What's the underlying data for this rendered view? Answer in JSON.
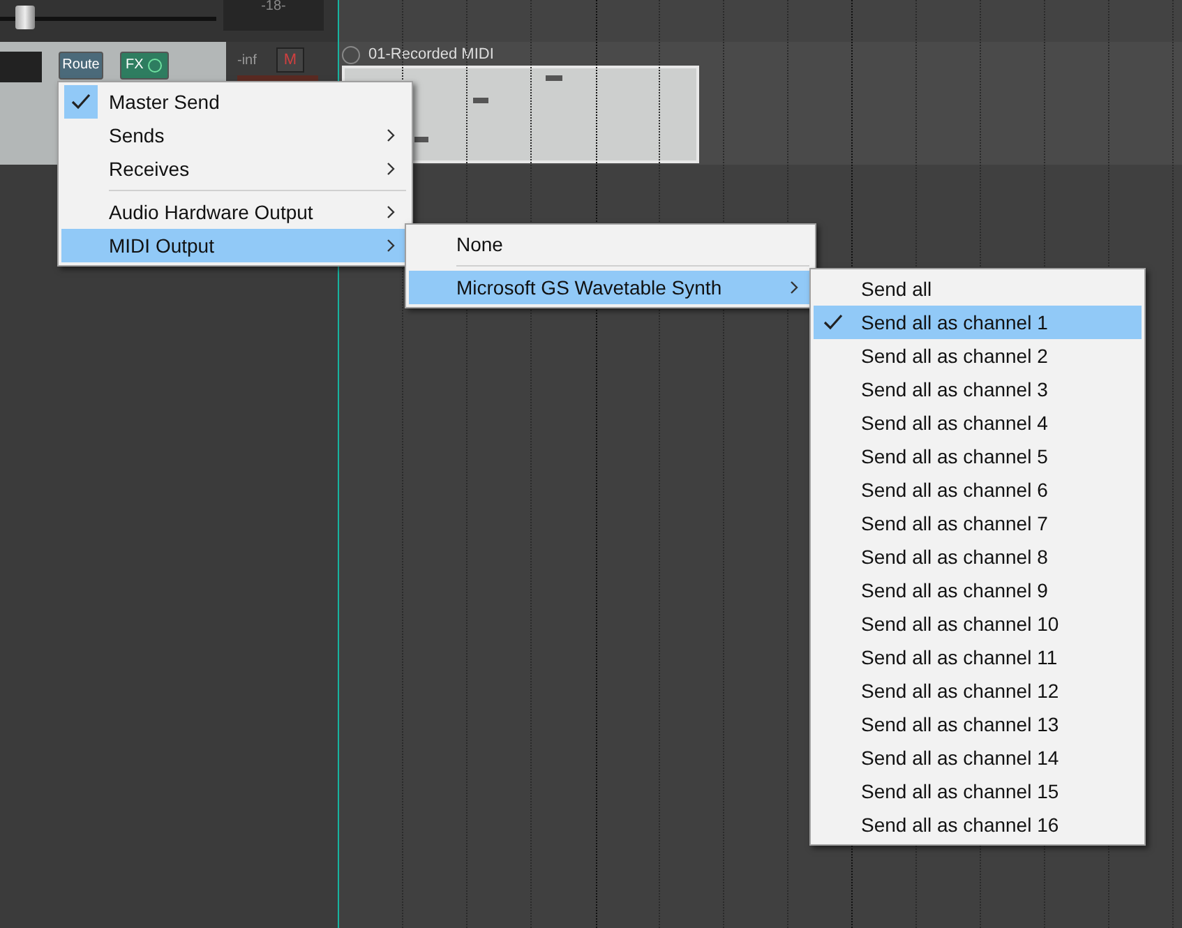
{
  "mixer": {
    "meter_label": "-18-",
    "volume_slider": {
      "level": 0.07
    }
  },
  "track": {
    "route_button": "Route",
    "fx_button": "FX",
    "meter_reading": "-inf",
    "mute_button": "M"
  },
  "item": {
    "name": "01-Recorded MIDI"
  },
  "menus": [
    {
      "items": [
        {
          "kind": "item",
          "label": "Master Send",
          "checked": true,
          "selected": false,
          "submenu": false
        },
        {
          "kind": "item",
          "label": "Sends",
          "checked": false,
          "selected": false,
          "submenu": true
        },
        {
          "kind": "item",
          "label": "Receives",
          "checked": false,
          "selected": false,
          "submenu": true
        },
        {
          "kind": "separator"
        },
        {
          "kind": "item",
          "label": "Audio Hardware Output",
          "checked": false,
          "selected": false,
          "submenu": true
        },
        {
          "kind": "item",
          "label": "MIDI Output",
          "checked": false,
          "selected": true,
          "submenu": true
        }
      ]
    },
    {
      "items": [
        {
          "kind": "item",
          "label": "None",
          "checked": false,
          "selected": false,
          "submenu": false
        },
        {
          "kind": "separator"
        },
        {
          "kind": "item",
          "label": "Microsoft GS Wavetable Synth",
          "checked": false,
          "selected": true,
          "submenu": true
        }
      ]
    },
    {
      "items": [
        {
          "kind": "item",
          "label": "Send all",
          "checked": false,
          "selected": false,
          "submenu": false
        },
        {
          "kind": "item",
          "label": "Send all as channel 1",
          "checked": true,
          "selected": true,
          "submenu": false
        },
        {
          "kind": "item",
          "label": "Send all as channel 2",
          "checked": false,
          "selected": false,
          "submenu": false
        },
        {
          "kind": "item",
          "label": "Send all as channel 3",
          "checked": false,
          "selected": false,
          "submenu": false
        },
        {
          "kind": "item",
          "label": "Send all as channel 4",
          "checked": false,
          "selected": false,
          "submenu": false
        },
        {
          "kind": "item",
          "label": "Send all as channel 5",
          "checked": false,
          "selected": false,
          "submenu": false
        },
        {
          "kind": "item",
          "label": "Send all as channel 6",
          "checked": false,
          "selected": false,
          "submenu": false
        },
        {
          "kind": "item",
          "label": "Send all as channel 7",
          "checked": false,
          "selected": false,
          "submenu": false
        },
        {
          "kind": "item",
          "label": "Send all as channel 8",
          "checked": false,
          "selected": false,
          "submenu": false
        },
        {
          "kind": "item",
          "label": "Send all as channel 9",
          "checked": false,
          "selected": false,
          "submenu": false
        },
        {
          "kind": "item",
          "label": "Send all as channel 10",
          "checked": false,
          "selected": false,
          "submenu": false
        },
        {
          "kind": "item",
          "label": "Send all as channel 11",
          "checked": false,
          "selected": false,
          "submenu": false
        },
        {
          "kind": "item",
          "label": "Send all as channel 12",
          "checked": false,
          "selected": false,
          "submenu": false
        },
        {
          "kind": "item",
          "label": "Send all as channel 13",
          "checked": false,
          "selected": false,
          "submenu": false
        },
        {
          "kind": "item",
          "label": "Send all as channel 14",
          "checked": false,
          "selected": false,
          "submenu": false
        },
        {
          "kind": "item",
          "label": "Send all as channel 15",
          "checked": false,
          "selected": false,
          "submenu": false
        },
        {
          "kind": "item",
          "label": "Send all as channel 16",
          "checked": false,
          "selected": false,
          "submenu": false
        }
      ]
    }
  ]
}
